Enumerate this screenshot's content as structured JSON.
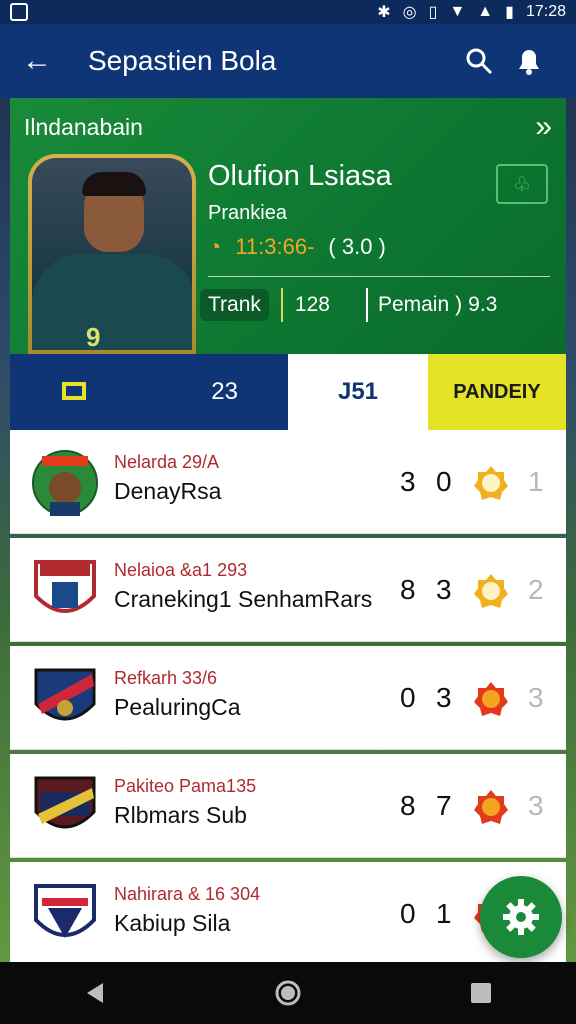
{
  "status": {
    "time": "17:28"
  },
  "appbar": {
    "title": "Sepastien Bola"
  },
  "hero": {
    "label": "Ilndanabain",
    "name": "Olufion Lsiasa",
    "role": "Prankiea",
    "time": "11:3:66-",
    "score": "( 3.0 )",
    "stat_pill": "Trank",
    "stat_value": "128",
    "stat_label": "Pemain",
    "stat_value2": "9.3",
    "jersey": "9"
  },
  "tabs": {
    "a_value": "23",
    "b_label": "J51",
    "c_label": "PANDEIY"
  },
  "teams": [
    {
      "sub": "Nelarda 29/A",
      "name": "DenayRsa",
      "s1": "3",
      "s2": "0",
      "rank": "1",
      "medal_color": "#f2b01e"
    },
    {
      "sub": "Nelaioa &a1 293",
      "name": "Craneking1 SenhamRars",
      "s1": "8",
      "s2": "3",
      "rank": "2",
      "medal_color": "#f2b01e"
    },
    {
      "sub": "Refkarh 33/6",
      "name": "PealuringCa",
      "s1": "0",
      "s2": "3",
      "rank": "3",
      "medal_color": "#e23a1a"
    },
    {
      "sub": "Pakiteo Pama135",
      "name": "Rlbmars Sub",
      "s1": "8",
      "s2": "7",
      "rank": "3",
      "medal_color": "#e23a1a"
    },
    {
      "sub": "Nahirara & 16 304",
      "name": "Kabiup Sila",
      "s1": "0",
      "s2": "1",
      "rank": "",
      "medal_color": "#e23a1a"
    }
  ]
}
